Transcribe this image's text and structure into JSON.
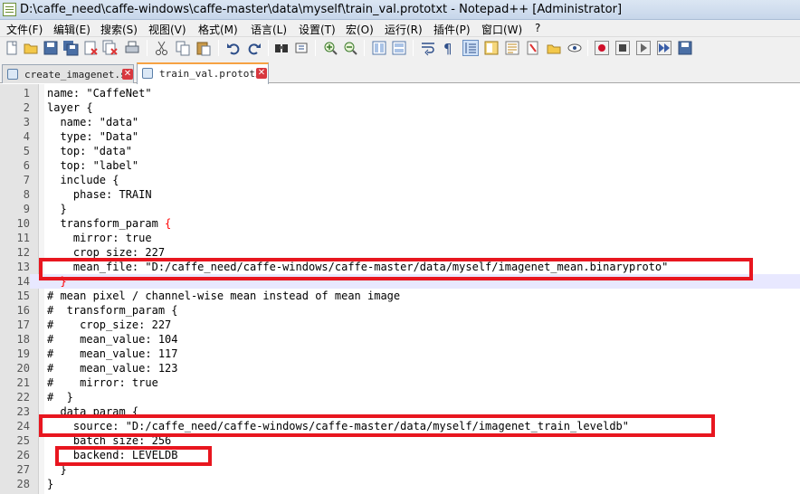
{
  "window": {
    "title": "D:\\caffe_need\\caffe-windows\\caffe-master\\data\\myself\\train_val.prototxt - Notepad++ [Administrator]"
  },
  "menu": [
    {
      "label": "文件(F)"
    },
    {
      "label": "编辑(E)"
    },
    {
      "label": "搜索(S)"
    },
    {
      "label": "视图(V)"
    },
    {
      "label": "格式(M)"
    },
    {
      "label": "语言(L)"
    },
    {
      "label": "设置(T)"
    },
    {
      "label": "宏(O)"
    },
    {
      "label": "运行(R)"
    },
    {
      "label": "插件(P)"
    },
    {
      "label": "窗口(W)"
    },
    {
      "label": "?"
    }
  ],
  "toolbar": {
    "icons": [
      "new-file-icon",
      "open-file-icon",
      "save-icon",
      "save-all-icon",
      "close-icon",
      "close-all-icon",
      "print-icon",
      "cut-icon",
      "copy-icon",
      "paste-icon",
      "undo-icon",
      "redo-icon",
      "find-icon",
      "replace-icon",
      "zoom-in-icon",
      "zoom-out-icon",
      "sync-vertical-icon",
      "sync-horizontal-icon",
      "word-wrap-icon",
      "show-all-chars-icon",
      "indent-guide-icon",
      "doc-map-icon",
      "function-list-icon",
      "folder-workspace-icon",
      "monitoring-icon",
      "record-macro-icon",
      "stop-record-icon",
      "play-macro-icon",
      "run-macro-multiple-icon",
      "save-macro-icon"
    ]
  },
  "tabs": [
    {
      "label": "create_imagenet.sh",
      "active": false
    },
    {
      "label": "train_val.prototxt",
      "active": true
    }
  ],
  "editor": {
    "current_line": 14,
    "lines": [
      {
        "n": "1",
        "text": "name: \"CaffeNet\""
      },
      {
        "n": "2",
        "text": "layer {"
      },
      {
        "n": "3",
        "text": "  name: \"data\""
      },
      {
        "n": "4",
        "text": "  type: \"Data\""
      },
      {
        "n": "5",
        "text": "  top: \"data\""
      },
      {
        "n": "6",
        "text": "  top: \"label\""
      },
      {
        "n": "7",
        "text": "  include {"
      },
      {
        "n": "8",
        "text": "    phase: TRAIN"
      },
      {
        "n": "9",
        "text": "  }"
      },
      {
        "n": "10",
        "text": "  transform_param ",
        "brace": "{"
      },
      {
        "n": "11",
        "text": "    mirror: true"
      },
      {
        "n": "12",
        "text": "    crop_size: 227"
      },
      {
        "n": "13",
        "text": "    mean_file: \"D:/caffe_need/caffe-windows/caffe-master/data/myself/imagenet_mean.binaryproto\""
      },
      {
        "n": "14",
        "text": "  ",
        "brace": "}"
      },
      {
        "n": "15",
        "text": "# mean pixel / channel-wise mean instead of mean image"
      },
      {
        "n": "16",
        "text": "#  transform_param {"
      },
      {
        "n": "17",
        "text": "#    crop_size: 227"
      },
      {
        "n": "18",
        "text": "#    mean_value: 104"
      },
      {
        "n": "19",
        "text": "#    mean_value: 117"
      },
      {
        "n": "20",
        "text": "#    mean_value: 123"
      },
      {
        "n": "21",
        "text": "#    mirror: true"
      },
      {
        "n": "22",
        "text": "#  }"
      },
      {
        "n": "23",
        "text": "  data_param {"
      },
      {
        "n": "24",
        "text": "    source: \"D:/caffe_need/caffe-windows/caffe-master/data/myself/imagenet_train_leveldb\""
      },
      {
        "n": "25",
        "text": "    batch_size: 256"
      },
      {
        "n": "26",
        "text": "    backend: LEVELDB"
      },
      {
        "n": "27",
        "text": "  }"
      },
      {
        "n": "28",
        "text": "}"
      }
    ]
  },
  "colors": {
    "annotation_box": "#e8161f",
    "current_line_bg": "#e8e8ff",
    "active_tab_accent": "#f6a243"
  }
}
